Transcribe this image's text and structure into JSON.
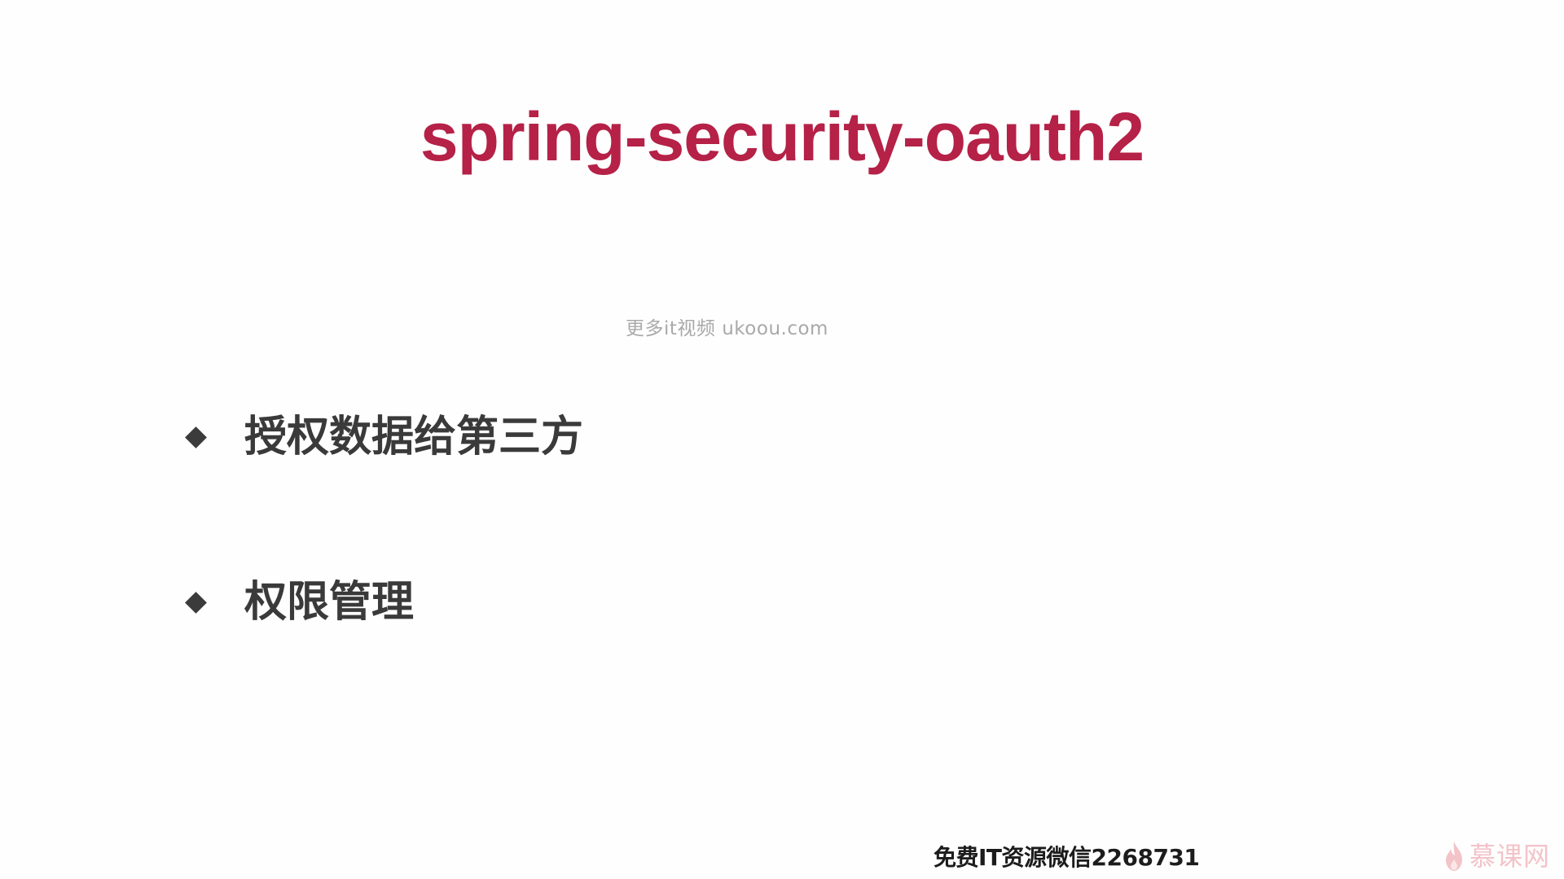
{
  "slide": {
    "title": "spring-security-oauth2",
    "watermark": "更多it视频 ukoou.com",
    "bullets": [
      {
        "text": "授权数据给第三方"
      },
      {
        "text": "权限管理"
      }
    ],
    "footer": "免费IT资源微信2268731",
    "logo": {
      "text": "慕课网",
      "icon": "flame-icon"
    }
  },
  "colors": {
    "title": "#b52147",
    "bullet_text": "#3a3a3a",
    "bullet_marker": "#3b3b3b",
    "watermark": "#a9a9a9",
    "footer": "#1c1c1c",
    "logo": "#f3c3c8"
  }
}
